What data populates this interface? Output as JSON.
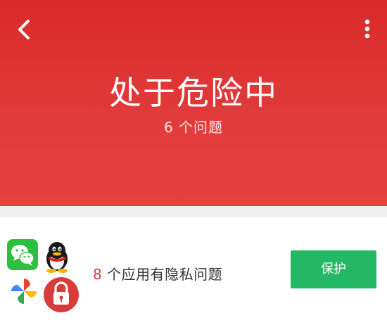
{
  "header": {
    "status_title": "处于危险中",
    "issue_summary": "6 个问题"
  },
  "privacy_card": {
    "app_count": "8",
    "issue_label": " 个应用有隐私问题",
    "protect_label": "保护",
    "app_icons": [
      "wechat-icon",
      "qq-icon",
      "photos-icon",
      "app-lock-icon"
    ]
  },
  "colors": {
    "danger_red": "#dd3232",
    "protect_green": "#25b864",
    "count_red": "#d93a3a"
  }
}
